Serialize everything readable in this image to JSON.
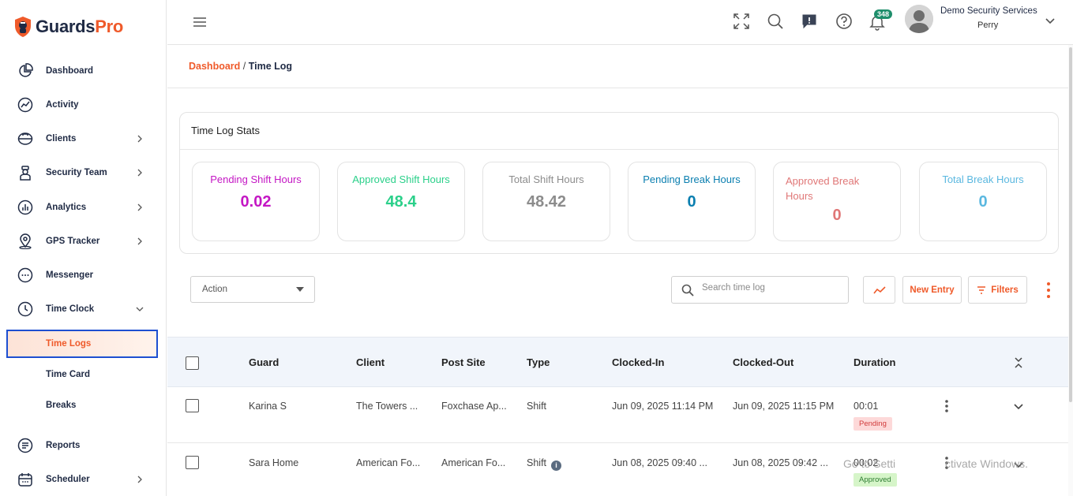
{
  "brand": {
    "part1": "Guards",
    "part2": "Pro"
  },
  "sidebar": {
    "items": [
      {
        "label": "Dashboard"
      },
      {
        "label": "Activity"
      },
      {
        "label": "Clients"
      },
      {
        "label": "Security Team"
      },
      {
        "label": "Analytics"
      },
      {
        "label": "GPS Tracker"
      },
      {
        "label": "Messenger"
      },
      {
        "label": "Time Clock"
      },
      {
        "label": "Reports"
      },
      {
        "label": "Scheduler"
      }
    ],
    "subitems": [
      {
        "label": "Time Logs"
      },
      {
        "label": "Time Card"
      },
      {
        "label": "Breaks"
      }
    ]
  },
  "topbar": {
    "notification_count": "348",
    "user_org": "Demo Security Services",
    "user_name": "Perry"
  },
  "breadcrumb": {
    "link": "Dashboard",
    "separator": " / ",
    "current": "Time Log"
  },
  "stats": {
    "title": "Time Log Stats",
    "items": [
      {
        "label": "Pending Shift Hours",
        "value": "0.02",
        "color": "#c417c4"
      },
      {
        "label": "Approved Shift Hours",
        "value": "48.4",
        "color": "#2bd08a"
      },
      {
        "label": "Total Shift Hours",
        "value": "48.42",
        "color": "#8c8c8c"
      },
      {
        "label": "Pending Break Hours",
        "value": "0",
        "color": "#0b7fb0"
      },
      {
        "label": "Approved Break Hours",
        "value": "0",
        "color": "#e07777"
      },
      {
        "label": "Total Break Hours",
        "value": "0",
        "color": "#5bb8e0"
      }
    ]
  },
  "toolbar": {
    "action_label": "Action",
    "search_placeholder": "Search time log",
    "new_entry_label": "New Entry",
    "filters_label": "Filters"
  },
  "table": {
    "columns": [
      "Guard",
      "Client",
      "Post Site",
      "Type",
      "Clocked-In",
      "Clocked-Out",
      "Duration"
    ],
    "rows": [
      {
        "guard": "Karina S",
        "client": "The Towers ...",
        "post_site": "Foxchase Ap...",
        "type": "Shift",
        "clocked_in": "Jun 09, 2025 11:14 PM",
        "clocked_out": "Jun 09, 2025 11:15 PM",
        "duration": "00:01",
        "status": "Pending"
      },
      {
        "guard": "Sara Home",
        "client": "American Fo...",
        "post_site": "American Fo...",
        "type": "Shift",
        "clocked_in": "Jun 08, 2025 09:40 ...",
        "clocked_out": "Jun 08, 2025 09:42 ...",
        "duration": "00:02",
        "status": "Approved"
      }
    ]
  },
  "watermark": {
    "left": "Go to Setti",
    "right": "ctivate Windows."
  },
  "colors": {
    "accent": "#ef5a2a",
    "navy": "#1f2a44",
    "selection_border": "#1d4fd1"
  }
}
